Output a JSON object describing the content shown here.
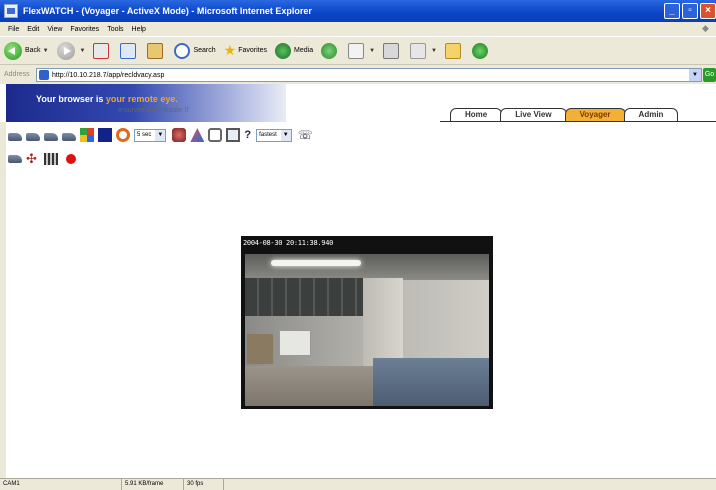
{
  "window": {
    "title": "FlexWATCH - (Voyager - ActiveX Mode) - Microsoft Internet Explorer",
    "min_label": "_",
    "max_label": "▫",
    "close_label": "×"
  },
  "menu": [
    "File",
    "Edit",
    "View",
    "Favorites",
    "Tools",
    "Help"
  ],
  "toolbar": {
    "back_label": "Back",
    "search_label": "Search",
    "favorites_label": "Favorites",
    "media_label": "Media"
  },
  "address": {
    "label": "Address",
    "url": "http://10.10.218.7/app/recldvacy.asp",
    "go_label": "Go"
  },
  "banner": {
    "tagline_start": "Your browser is",
    "tagline_highlight": " your remote eye.",
    "subtitle": "e-surveillance leader !!"
  },
  "tabs": [
    {
      "label": "Home",
      "active": false
    },
    {
      "label": "Live View",
      "active": false
    },
    {
      "label": "Voyager",
      "active": true
    },
    {
      "label": "Admin",
      "active": false
    }
  ],
  "controls": {
    "interval_value": "5 sec",
    "speed_value": "fastest",
    "help_label": "?"
  },
  "video": {
    "timestamp": "2004-08-30 20:11:38.940"
  },
  "status": {
    "camera": "CAM1",
    "frame_size": "5.91 KB/frame",
    "fps": "30 fps"
  },
  "colors": {
    "titlebar": "#0a45c8",
    "active_tab": "#f3b036",
    "record": "#e01010"
  }
}
